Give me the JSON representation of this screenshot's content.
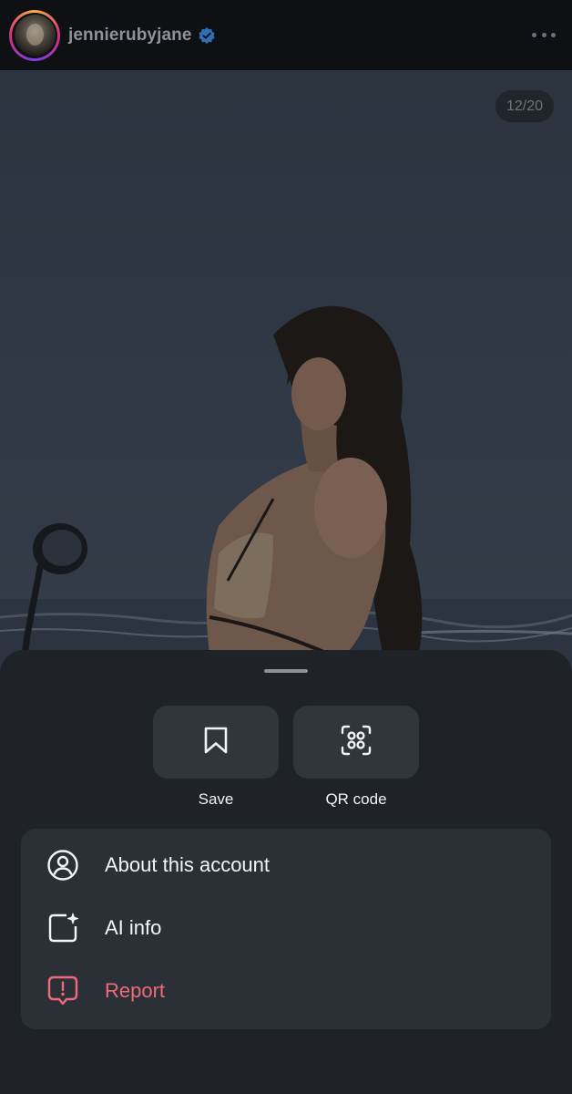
{
  "header": {
    "username": "jennierubyjane",
    "verified_icon": "verified-badge-icon",
    "more_icon": "more-options-icon"
  },
  "post": {
    "counter": "12/20",
    "photo_description_icon": "photo"
  },
  "sheet": {
    "quick_actions": [
      {
        "label": "Save",
        "icon": "bookmark-icon"
      },
      {
        "label": "QR code",
        "icon": "qr-code-icon"
      }
    ],
    "menu": [
      {
        "label": "About this account",
        "icon": "account-circle-icon"
      },
      {
        "label": "AI info",
        "icon": "ai-sparkle-icon"
      },
      {
        "label": "Report",
        "icon": "report-icon",
        "color": "#ef6b7b"
      }
    ]
  },
  "colors": {
    "sheet_bg": "#1f2227",
    "tile_bg": "#31353c",
    "menu_bg": "#2b2f36",
    "report": "#ef6b7b",
    "verified": "#3b82f6"
  }
}
